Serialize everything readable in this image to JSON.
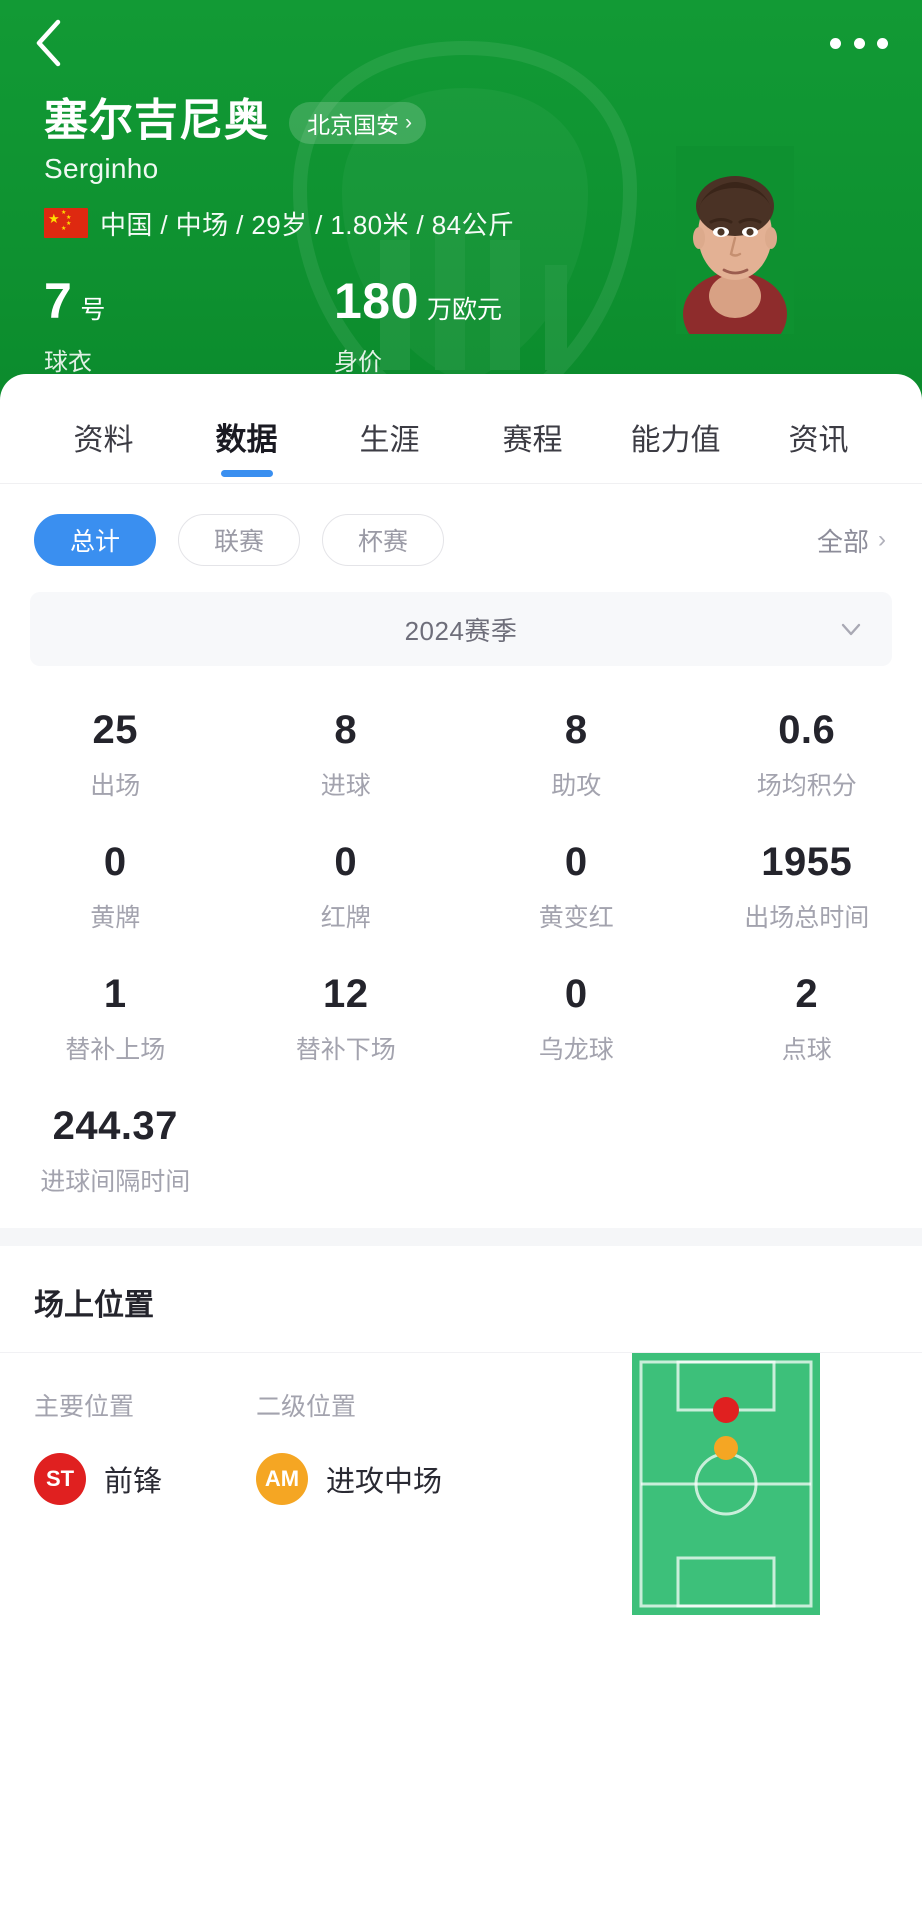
{
  "navbar": {
    "back_icon": "chevron-left-icon",
    "more_icon": "more-horizontal-icon"
  },
  "player": {
    "name": "塞尔吉尼奥",
    "alias": "Serginho",
    "team": "北京国安",
    "team_chevron": "›",
    "nationality": "中国",
    "position": "中场",
    "age": "29岁",
    "height": "1.80米",
    "weight": "84公斤",
    "meta_line": "中国 / 中场 / 29岁 / 1.80米 / 84公斤",
    "flag_icon": "china-flag-icon",
    "photo_icon": "player-portrait"
  },
  "hero_kpis": [
    {
      "value": "7",
      "unit": "号",
      "label": "球衣"
    },
    {
      "value": "180",
      "unit": "万欧元",
      "label": "身价"
    }
  ],
  "tabs": [
    {
      "label": "资料",
      "active": false
    },
    {
      "label": "数据",
      "active": true
    },
    {
      "label": "生涯",
      "active": false
    },
    {
      "label": "赛程",
      "active": false
    },
    {
      "label": "能力值",
      "active": false
    },
    {
      "label": "资讯",
      "active": false
    }
  ],
  "filters": {
    "chips": [
      {
        "label": "总计",
        "active": true
      },
      {
        "label": "联赛",
        "active": false
      },
      {
        "label": "杯赛",
        "active": false
      }
    ],
    "all_label": "全部",
    "all_chevron": "›"
  },
  "season": {
    "label": "2024赛季",
    "chevron_icon": "chevron-down-icon"
  },
  "stats": [
    {
      "value": "25",
      "label": "出场"
    },
    {
      "value": "8",
      "label": "进球"
    },
    {
      "value": "8",
      "label": "助攻"
    },
    {
      "value": "0.6",
      "label": "场均积分"
    },
    {
      "value": "0",
      "label": "黄牌"
    },
    {
      "value": "0",
      "label": "红牌"
    },
    {
      "value": "0",
      "label": "黄变红"
    },
    {
      "value": "1955",
      "label": "出场总时间"
    },
    {
      "value": "1",
      "label": "替补上场"
    },
    {
      "value": "12",
      "label": "替补下场"
    },
    {
      "value": "0",
      "label": "乌龙球"
    },
    {
      "value": "2",
      "label": "点球"
    },
    {
      "value": "244.37",
      "label": "进球间隔时间"
    }
  ],
  "position_section": {
    "title": "场上位置",
    "primary_head": "主要位置",
    "secondary_head": "二级位置",
    "primary": {
      "code": "ST",
      "name": "前锋",
      "color": "#E02020"
    },
    "secondary": {
      "code": "AM",
      "name": "进攻中场",
      "color": "#F5A623"
    },
    "pitch_icon": "football-pitch-icon"
  },
  "colors": {
    "header_green": "#0E9130",
    "accent_blue": "#3A8FF0",
    "pitch_green": "#3DC07A",
    "primary_red": "#E02020",
    "secondary_amber": "#F5A623"
  }
}
